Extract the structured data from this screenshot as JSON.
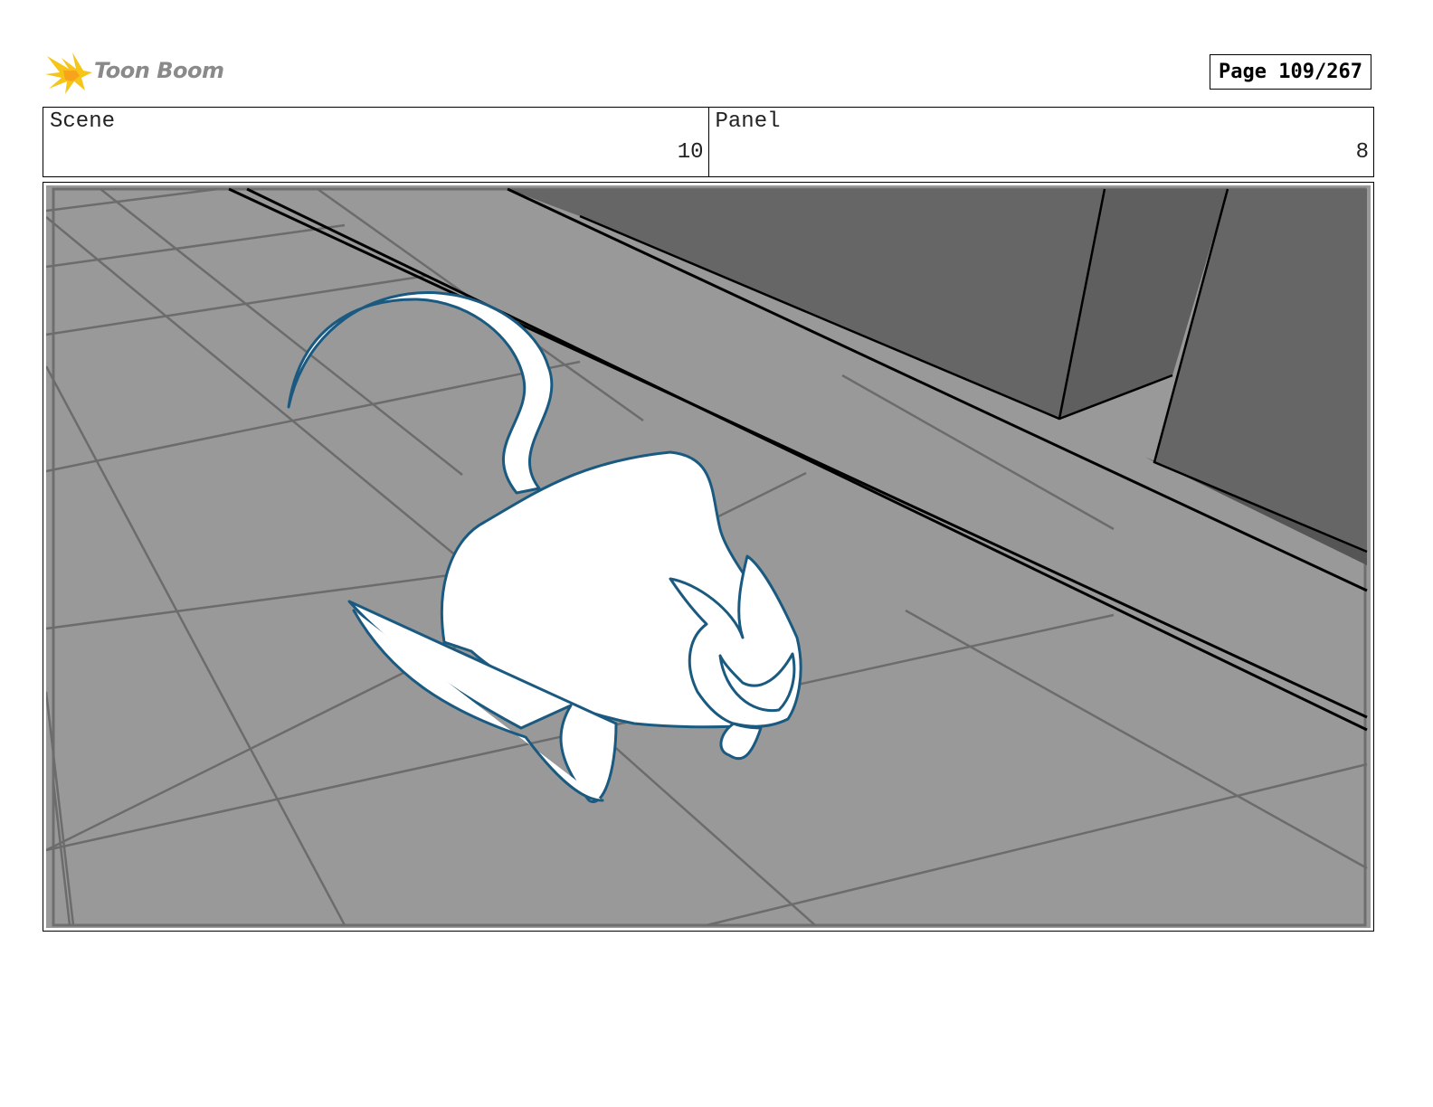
{
  "header": {
    "logo_text": "Toon Boom",
    "page_label": "Page 109/267"
  },
  "info": {
    "scene_label": "Scene",
    "scene_value": "10",
    "panel_label": "Panel",
    "panel_value": "8"
  },
  "colors": {
    "floor": "#999999",
    "wall": "#666666",
    "sketch_line": "#1a5a80",
    "logo_accent": "#f5c518"
  },
  "icons": {
    "logo": "toon-boom-star-icon"
  }
}
